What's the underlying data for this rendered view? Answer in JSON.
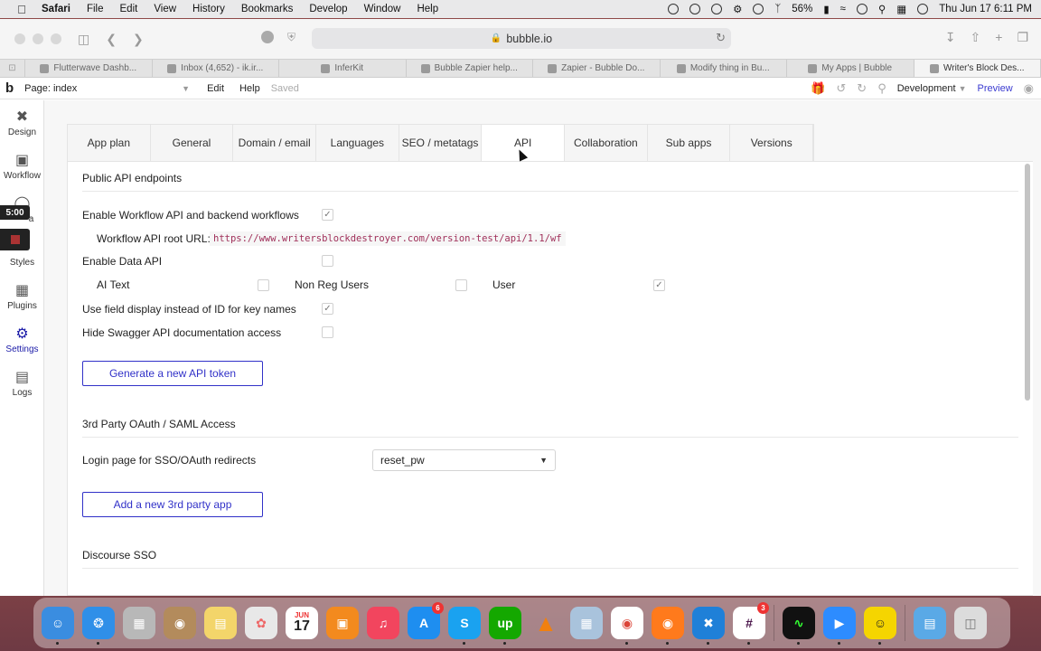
{
  "menubar": {
    "app": "Safari",
    "items": [
      "File",
      "Edit",
      "View",
      "History",
      "Bookmarks",
      "Develop",
      "Window",
      "Help"
    ],
    "battery": "56%",
    "datetime": "Thu Jun 17  6:11 PM"
  },
  "browser": {
    "url": "bubble.io",
    "tabs": [
      {
        "label": "Flutterwave Dashb..."
      },
      {
        "label": "Inbox (4,652) - ik.ir..."
      },
      {
        "label": "InferKit"
      },
      {
        "label": "Bubble Zapier help..."
      },
      {
        "label": "Zapier - Bubble Do..."
      },
      {
        "label": "Modify thing in Bu..."
      },
      {
        "label": "My Apps | Bubble"
      },
      {
        "label": "Writer's Block Des..."
      }
    ]
  },
  "editor": {
    "page_label": "Page: index",
    "edit": "Edit",
    "help": "Help",
    "saved": "Saved",
    "env": "Development",
    "preview": "Preview"
  },
  "leftnav": {
    "items": [
      {
        "label": "Design",
        "icon": "design-icon"
      },
      {
        "label": "Workflow",
        "icon": "workflow-icon"
      },
      {
        "label": "a",
        "icon": "data-icon"
      },
      {
        "label": "Styles",
        "icon": "brush-icon"
      },
      {
        "label": "Plugins",
        "icon": "plugin-icon"
      },
      {
        "label": "Settings",
        "icon": "gear-icon"
      },
      {
        "label": "Logs",
        "icon": "logs-icon"
      }
    ],
    "timer": "5:00"
  },
  "settings_tabs": [
    "App plan",
    "General",
    "Domain / email",
    "Languages",
    "SEO / metatags",
    "API",
    "Collaboration",
    "Sub apps",
    "Versions"
  ],
  "api": {
    "public_title": "Public API endpoints",
    "enable_workflow_label": "Enable Workflow API and backend workflows",
    "workflow_root_label": "Workflow API root URL:",
    "workflow_root_url": "https://www.writersblockdestroyer.com/version-test/api/1.1/wf",
    "enable_data_label": "Enable Data API",
    "data_types": [
      {
        "label": "AI Text",
        "checked": false
      },
      {
        "label": "Non Reg Users",
        "checked": false
      },
      {
        "label": "User",
        "checked": true
      }
    ],
    "field_display_label": "Use field display instead of ID for key names",
    "hide_swagger_label": "Hide Swagger API documentation access",
    "generate_token_label": "Generate a new API token",
    "oauth_title": "3rd Party OAuth / SAML Access",
    "login_page_label": "Login page for SSO/OAuth redirects",
    "login_page_value": "reset_pw",
    "add_app_label": "Add a new 3rd party app",
    "discourse_title": "Discourse SSO"
  },
  "dock": {
    "calendar_month": "JUN",
    "calendar_day": "17",
    "appstore_badge": "6",
    "slack_badge": "3"
  },
  "colors": {
    "accent": "#3131c8",
    "settings_active": "#1a1aa8"
  }
}
